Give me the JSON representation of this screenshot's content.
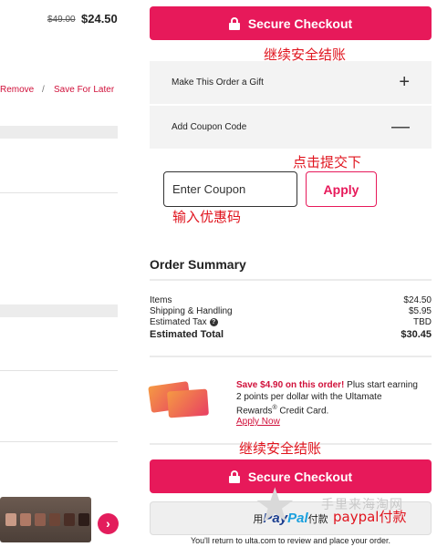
{
  "cart_item": {
    "old_price": "$49.00",
    "new_price": "$24.50",
    "remove_label": "Remove",
    "separator": "/",
    "save_for_later_label": "Save For Later"
  },
  "checkout": {
    "button_label": "Secure Checkout",
    "note_top": "继续安全结账",
    "note_bottom": "继续安全结账"
  },
  "options": {
    "gift_label": "Make This Order a Gift",
    "gift_symbol": "+",
    "coupon_label": "Add Coupon Code",
    "coupon_symbol": "—"
  },
  "coupon": {
    "placeholder": "Enter Coupon",
    "apply_label": "Apply",
    "note_apply": "点击提交下",
    "note_input": "输入优惠码"
  },
  "summary": {
    "title": "Order Summary",
    "items_label": "Items",
    "items_value": "$24.50",
    "shipping_label": "Shipping & Handling",
    "shipping_value": "$5.95",
    "tax_label": "Estimated Tax",
    "tax_help": "?",
    "tax_value": "TBD",
    "total_label": "Estimated Total",
    "total_value": "$30.45"
  },
  "promo": {
    "highlight": "Save $4.90 on this order!",
    "text": " Plus start earning 2 points per dollar with the Ultamate Rewards",
    "reg": "®",
    "text2": " Credit Card.",
    "apply_now": "Apply Now"
  },
  "paypal": {
    "prefix": "用",
    "brand_part1": "Pay",
    "brand_part2": "Pal",
    "suffix": "付款",
    "note": "paypal付款"
  },
  "footer_note": "You'll return to ulta.com to review and place your order.",
  "watermark": "手里来海淘网",
  "carousel_next_icon": "chevron-right-icon",
  "colors": {
    "accent": "#e7195a",
    "note_red": "#e0141e"
  }
}
